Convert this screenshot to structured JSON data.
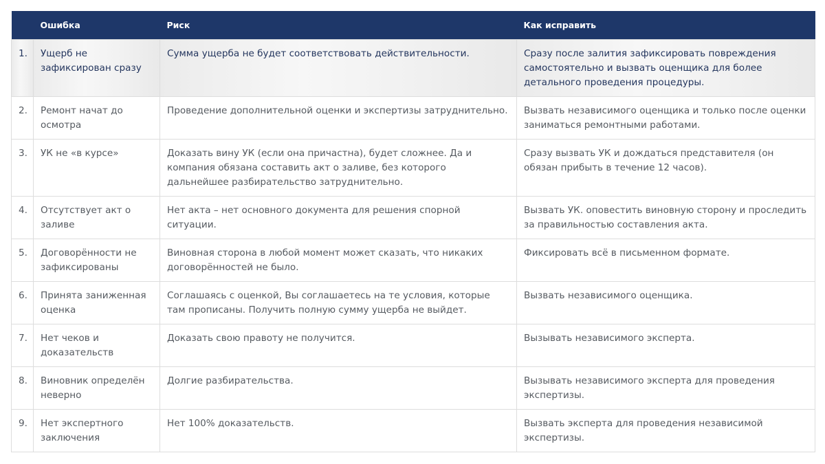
{
  "table": {
    "headers": {
      "num": "",
      "error": "Ошибка",
      "risk": "Риск",
      "fix": "Как исправить"
    },
    "rows": [
      {
        "num": "1.",
        "error": "Ущерб не зафиксирован сразу",
        "risk": "Сумма ущерба не будет соответствовать действительности.",
        "fix": "Сразу после залития зафиксировать повреждения самостоятельно и вызвать оценщика для более детального проведения процедуры."
      },
      {
        "num": "2.",
        "error": "Ремонт начат до осмотра",
        "risk": "Проведение дополнительной оценки и экспертизы затруднительно.",
        "fix": "Вызвать независимого оценщика и только после оценки заниматься ремонтными работами."
      },
      {
        "num": "3.",
        "error": "УК не «в курсе»",
        "risk": "Доказать вину УК (если она причастна), будет сложнее. Да и компания обязана составить акт о заливе, без которого дальнейшее разбирательство затруднительно.",
        "fix": "Сразу вызвать УК и дождаться представителя (он обязан прибыть в течение 12 часов)."
      },
      {
        "num": "4.",
        "error": "Отсутствует акт о заливе",
        "risk": "Нет акта – нет основного документа для решения спорной ситуации.",
        "fix": "Вызвать УК. оповестить виновную сторону и проследить за правильностью составления акта."
      },
      {
        "num": "5.",
        "error": "Договорённости не зафиксированы",
        "risk": "Виновная сторона в любой момент может сказать, что никаких договорённостей не было.",
        "fix": "Фиксировать всё в письменном формате."
      },
      {
        "num": "6.",
        "error": "Принята заниженная оценка",
        "risk": "Соглашаясь с оценкой, Вы соглашаетесь на те условия, которые там прописаны. Получить полную сумму ущерба не выйдет.",
        "fix": "Вызвать независимого оценщика."
      },
      {
        "num": "7.",
        "error": "Нет чеков и доказательств",
        "risk": "Доказать свою правоту не получится.",
        "fix": "Вызывать независимого эксперта."
      },
      {
        "num": "8.",
        "error": "Виновник определён неверно",
        "risk": "Долгие разбирательства.",
        "fix": "Вызывать независимого эксперта для проведения экспертизы."
      },
      {
        "num": "9.",
        "error": "Нет экспертного заключения",
        "risk": "Нет 100% доказательств.",
        "fix": "Вызвать эксперта для проведения независимой экспертизы."
      }
    ],
    "colors": {
      "header_bg": "#1e3769",
      "header_text": "#ffffff",
      "text": "#555a60",
      "highlight_text": "#24365e",
      "border": "#dddddd"
    }
  }
}
